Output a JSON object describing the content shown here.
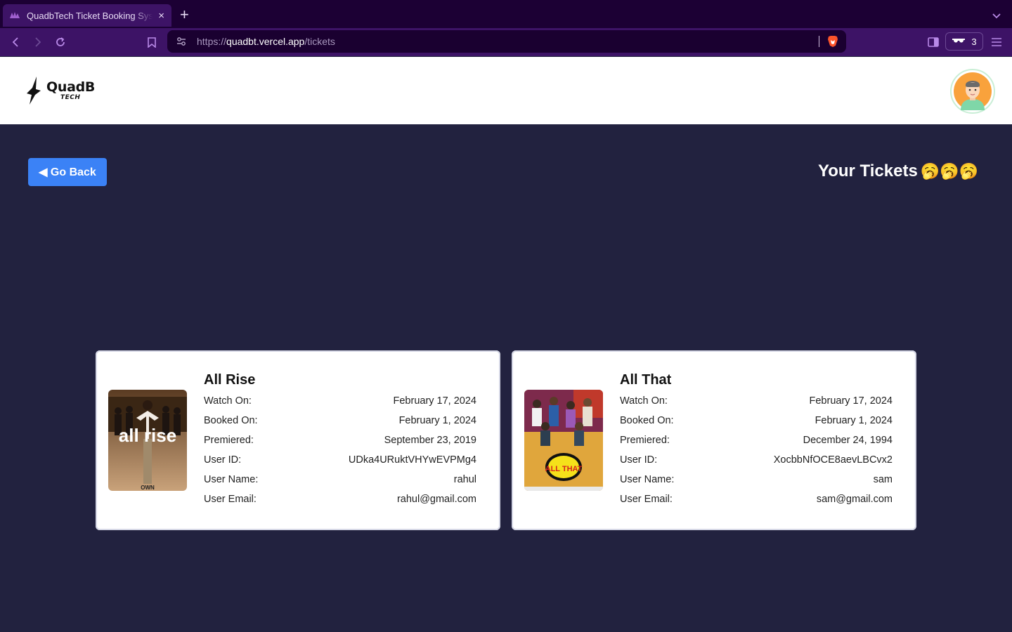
{
  "browser": {
    "tab_title": "QuadbTech Ticket Booking System",
    "tab_close": "×",
    "new_tab": "+",
    "url_prefix": "https://",
    "url_host": "quadbt.vercel.app",
    "url_path": "/tickets",
    "shields_count": "3"
  },
  "header": {
    "logo_main": "QuadB",
    "logo_sub": "TECH"
  },
  "main": {
    "go_back_label": "◀ Go Back",
    "page_title": "Your Tickets",
    "page_title_emoji": "🥱🥱🥱"
  },
  "labels": {
    "watch_on": "Watch On:",
    "booked_on": "Booked On:",
    "premiered": "Premiered:",
    "user_id": "User ID:",
    "user_name": "User Name:",
    "user_email": "User Email:"
  },
  "tickets": [
    {
      "title": "All Rise",
      "poster_text": "all rise",
      "poster_caption": "OWN",
      "watch_on": "February 17, 2024",
      "booked_on": "February 1, 2024",
      "premiered": "September 23, 2019",
      "user_id": "UDka4URuktVHYwEVPMg4",
      "user_name": "rahul",
      "user_email": "rahul@gmail.com"
    },
    {
      "title": "All That",
      "poster_text": "ALL THAT",
      "watch_on": "February 17, 2024",
      "booked_on": "February 1, 2024",
      "premiered": "December 24, 1994",
      "user_id": "XocbbNfOCE8aevLBCvx2",
      "user_name": "sam",
      "user_email": "sam@gmail.com"
    }
  ],
  "colors": {
    "page_bg": "#22223f",
    "button_blue": "#3b82f6",
    "chrome_dark": "#1c0034",
    "chrome_purple": "#3d1366"
  }
}
